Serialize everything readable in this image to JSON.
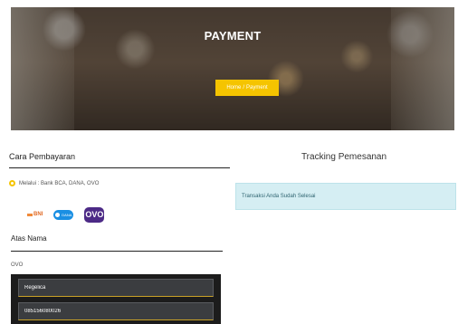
{
  "hero": {
    "title": "PAYMENT",
    "breadcrumb": {
      "home": "Home",
      "separator": "/",
      "current": "Payment"
    },
    "accent_color": "#f5c400"
  },
  "payment_method": {
    "heading": "Cara Pembayaran",
    "via_text": "Melalui : Bank BCA, DANA, OVO",
    "logos": {
      "bni": "BNI",
      "dana": "DANA",
      "ovo": "OVO"
    }
  },
  "account": {
    "heading": "Atas Nama",
    "provider": "OVO",
    "name_value": "Regelica",
    "number_value": "085156080026"
  },
  "tracking": {
    "heading": "Tracking Pemesanan",
    "status_message": "Transaksi Anda Sudah Selesai",
    "status_color": "#d5eef3"
  }
}
